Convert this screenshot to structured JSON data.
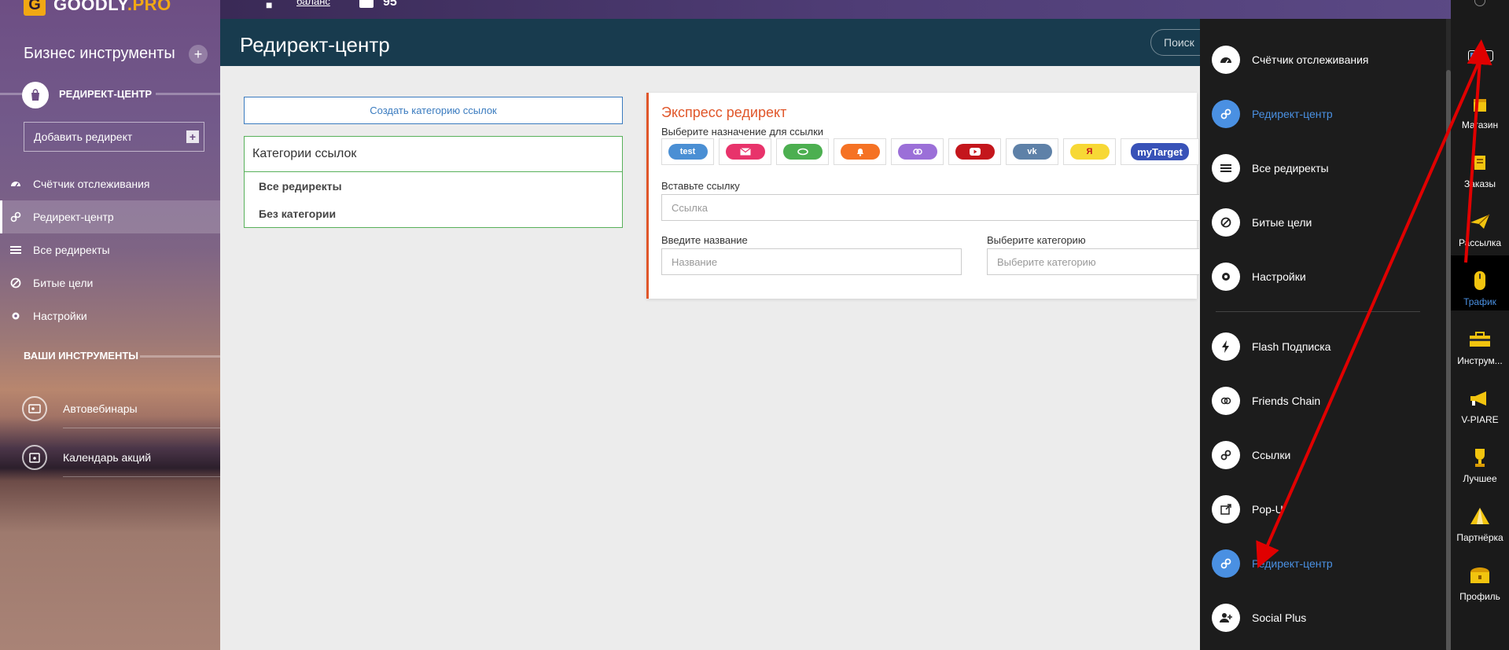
{
  "brand": {
    "logo_letter": "G",
    "name_main": "GOODLY",
    "name_suffix": ".PRO",
    "accent": "#f2a813"
  },
  "sidebar": {
    "business_title": "Бизнес инструменты",
    "add_symbol": "+",
    "section_label": "РЕДИРЕКТ-ЦЕНТР",
    "add_redirect_label": "Добавить редирект",
    "nav": [
      {
        "label": "Счётчик отслеживания",
        "icon": "gauge-icon"
      },
      {
        "label": "Редирект-центр",
        "icon": "link-icon",
        "active": true
      },
      {
        "label": "Все редиректы",
        "icon": "list-icon"
      },
      {
        "label": "Битые цели",
        "icon": "ban-icon"
      },
      {
        "label": "Настройки",
        "icon": "gear-icon"
      }
    ],
    "tools_heading": "ВАШИ ИНСТРУМЕНТЫ",
    "tools": [
      {
        "label": "Автовебинары",
        "icon": "webinar-icon"
      },
      {
        "label": "Календарь акций",
        "icon": "calendar-icon"
      }
    ]
  },
  "topbar": {
    "link_text": "баланс",
    "balance": "95"
  },
  "page": {
    "title": "Редирект-центр",
    "search_label": "Поиск"
  },
  "left_panel": {
    "create_category_label": "Создать категорию ссылок",
    "categories_title": "Категории ссылок",
    "categories": [
      "Все редиректы",
      "Без категории"
    ]
  },
  "express": {
    "title": "Экспресс редирект",
    "destination_label": "Выберите назначение для ссылки",
    "services": [
      {
        "text": "test",
        "color": "#4a8fd4"
      },
      {
        "text": "",
        "color": "#e8336b",
        "icon": "mail-icon"
      },
      {
        "text": "",
        "color": "#4caf50",
        "icon": "handshake-icon"
      },
      {
        "text": "",
        "color": "#f57224",
        "icon": "bell-icon"
      },
      {
        "text": "",
        "color": "#9b6fd8",
        "icon": "chain-icon"
      },
      {
        "text": "",
        "color": "#c4161c",
        "icon": "youtube-icon"
      },
      {
        "text": "vk",
        "color": "#5e81a8"
      },
      {
        "text": "Я",
        "color": "#f7d835"
      },
      {
        "text": "myTarget",
        "color": "#3852b8"
      }
    ],
    "link_label": "Вставьте ссылку",
    "link_placeholder": "Ссылка",
    "name_label": "Введите название",
    "name_placeholder": "Название",
    "category_label": "Выберите категорию",
    "category_placeholder": "Выберите категорию"
  },
  "menu": {
    "items": [
      {
        "label": "Счётчик отслеживания",
        "icon": "gauge-icon"
      },
      {
        "label": "Редирект-центр",
        "icon": "link-icon",
        "active": true
      },
      {
        "label": "Все редиректы",
        "icon": "list-icon"
      },
      {
        "label": "Битые цели",
        "icon": "ban-icon"
      },
      {
        "label": "Настройки",
        "icon": "gear-icon"
      },
      {
        "label": "Flash Подписка",
        "icon": "lightning-icon"
      },
      {
        "label": "Friends Chain",
        "icon": "chain-icon"
      },
      {
        "label": "Ссылки",
        "icon": "link-icon"
      },
      {
        "label": "Pop-U",
        "icon": "external-link-icon"
      },
      {
        "label": "Редирект-центр",
        "icon": "link-icon",
        "active": true
      },
      {
        "label": "Social Plus",
        "icon": "user-plus-icon"
      }
    ]
  },
  "rail": {
    "items": [
      {
        "label": "Магазин",
        "icon": "shop-icon"
      },
      {
        "label": "Заказы",
        "icon": "orders-icon"
      },
      {
        "label": "Рассылка",
        "icon": "mailing-icon"
      },
      {
        "label": "Трафик",
        "icon": "mouse-icon",
        "active": true
      },
      {
        "label": "Инструм...",
        "icon": "toolbox-icon"
      },
      {
        "label": "V-PIARE",
        "icon": "megaphone-icon"
      },
      {
        "label": "Лучшее",
        "icon": "trophy-icon"
      },
      {
        "label": "Партнёрка",
        "icon": "pyramid-icon"
      },
      {
        "label": "Профиль",
        "icon": "treasure-icon"
      }
    ]
  }
}
